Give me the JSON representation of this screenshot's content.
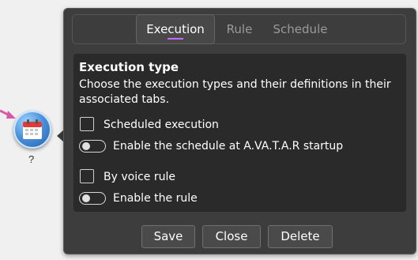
{
  "node": {
    "label": "?",
    "icon": "calendar-icon"
  },
  "tabs": [
    {
      "label": "Execution",
      "active": true
    },
    {
      "label": "Rule",
      "active": false
    },
    {
      "label": "Schedule",
      "active": false
    }
  ],
  "execution": {
    "title": "Execution type",
    "description": "Choose the execution types and their definitions in their associated tabs.",
    "scheduled_label": "Scheduled execution",
    "scheduled_checked": false,
    "enable_schedule_label": "Enable the schedule at A.VA.T.A.R startup",
    "enable_schedule_on": false,
    "voice_label": "By voice rule",
    "voice_checked": false,
    "enable_rule_label": "Enable the rule",
    "enable_rule_on": false
  },
  "buttons": {
    "save": "Save",
    "close": "Close",
    "delete": "Delete"
  },
  "colors": {
    "panel": "#3d3d3d",
    "content": "#2a2a2a",
    "tab_accent": "#c86bff",
    "node_blue": "#4a90d9"
  }
}
